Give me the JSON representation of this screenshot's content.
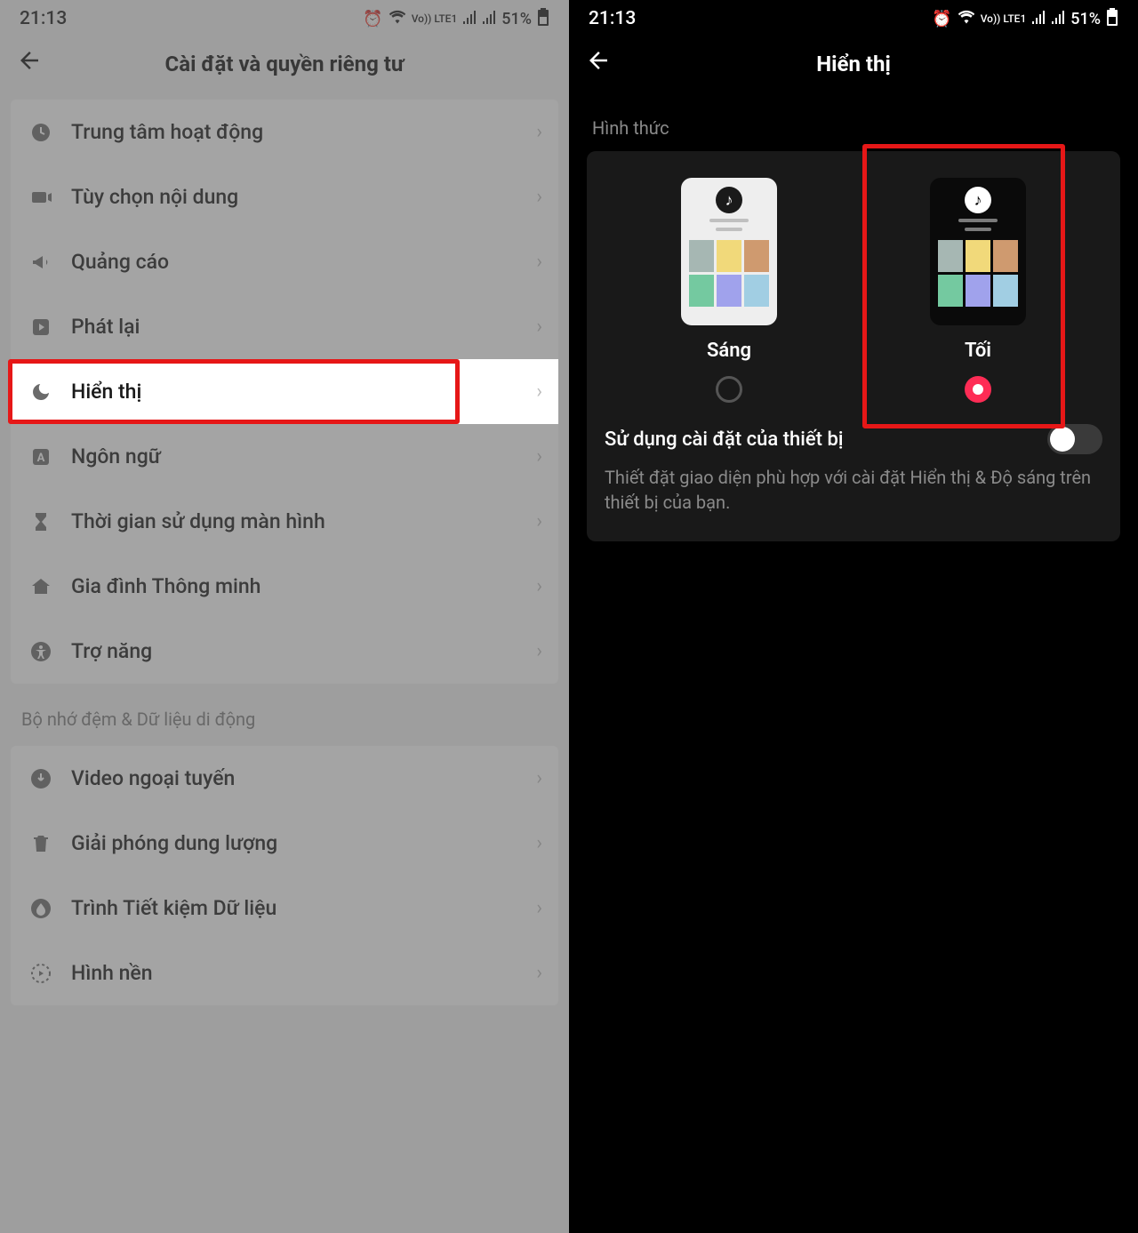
{
  "status": {
    "time": "21:13",
    "battery": "51%",
    "lte": "Vo)) LTE1"
  },
  "left": {
    "title": "Cài đặt và quyền riêng tư",
    "section2_title": "Bộ nhớ đệm & Dữ liệu di động",
    "items": [
      {
        "label": "Trung tâm hoạt động"
      },
      {
        "label": "Tùy chọn nội dung"
      },
      {
        "label": "Quảng cáo"
      },
      {
        "label": "Phát lại"
      },
      {
        "label": "Hiển thị"
      },
      {
        "label": "Ngôn ngữ"
      },
      {
        "label": "Thời gian sử dụng màn hình"
      },
      {
        "label": "Gia đình Thông minh"
      },
      {
        "label": "Trợ năng"
      }
    ],
    "items2": [
      {
        "label": "Video ngoại tuyến"
      },
      {
        "label": "Giải phóng dung lượng"
      },
      {
        "label": "Trình Tiết kiệm Dữ liệu"
      },
      {
        "label": "Hình nền"
      }
    ]
  },
  "right": {
    "title": "Hiển thị",
    "section_title": "Hình thức",
    "light_label": "Sáng",
    "dark_label": "Tối",
    "device_label": "Sử dụng cài đặt của thiết bị",
    "device_desc": "Thiết đặt giao diện phù hợp với cài đặt Hiển thị & Độ sáng trên thiết bị của bạn."
  }
}
